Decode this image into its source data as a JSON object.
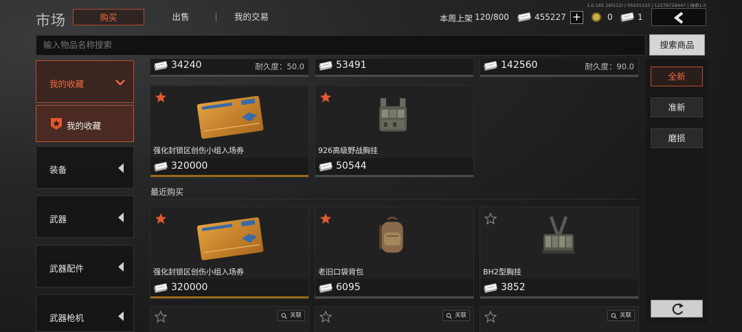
{
  "header": {
    "title": "市场",
    "tabs": [
      {
        "label": "购买",
        "active": true
      },
      {
        "label": "出售",
        "active": false
      },
      {
        "label": "我的交易",
        "active": false
      }
    ],
    "weekly_listing_label": "本周上架",
    "weekly_listing_value": "120/800",
    "cash_balance": "455227",
    "coin_balance": "0",
    "ticket_balance": "1",
    "version": "1.0.165.165(12) | 05031133 | 12276729447 | 待命1-5"
  },
  "search": {
    "placeholder": "输入物品名称搜索",
    "button_label": "搜索商品"
  },
  "sidebar": {
    "items": [
      {
        "label": "我的收藏",
        "type": "category-expanded"
      },
      {
        "label": "我的收藏",
        "type": "sub-selected"
      },
      {
        "label": "装备",
        "type": "category"
      },
      {
        "label": "武器",
        "type": "category"
      },
      {
        "label": "武器配件",
        "type": "category"
      },
      {
        "label": "武器枪机",
        "type": "category"
      }
    ]
  },
  "listings": {
    "top_partial_row": [
      {
        "price": "34240",
        "durability_label": "耐久度：50.0"
      },
      {
        "price": "53491",
        "durability_label": ""
      },
      {
        "price": "142560",
        "durability_label": "耐久度：90.0"
      }
    ],
    "favorites_row": [
      {
        "name": "强化封锁区创伤小组入场券",
        "price": "320000",
        "favorited": true
      },
      {
        "name": "926高级野战胸挂",
        "price": "50544",
        "favorited": true
      }
    ],
    "recent_section_label": "最近购买",
    "recent_row": [
      {
        "name": "强化封锁区创伤小组入场券",
        "price": "320000",
        "favorited": true
      },
      {
        "name": "老旧口袋背包",
        "price": "6095",
        "favorited": true
      },
      {
        "name": "BH2型胸挂",
        "price": "3852",
        "favorited": false
      }
    ],
    "associate_label": "关联"
  },
  "filters": {
    "buttons": [
      {
        "label": "全新",
        "active": true
      },
      {
        "label": "准新",
        "active": false
      },
      {
        "label": "磨损",
        "active": false
      }
    ]
  },
  "colors": {
    "accent": "#ef6a42",
    "accent_border": "#b24a2d",
    "background": "#1d1d1e"
  }
}
